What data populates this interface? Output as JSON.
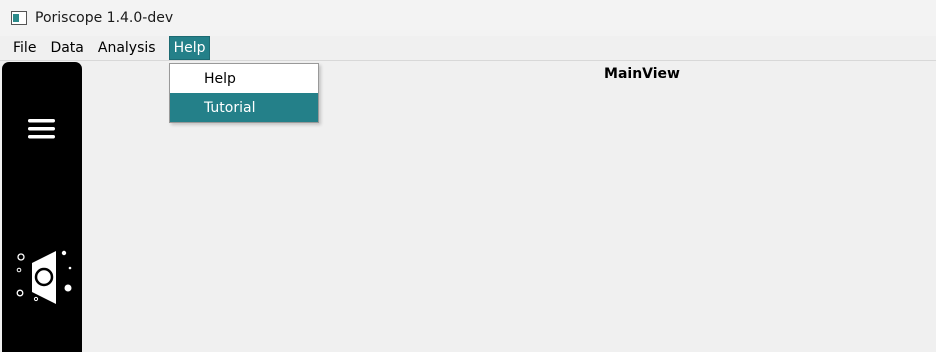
{
  "window": {
    "title": "Poriscope 1.4.0-dev",
    "app_icon": "app-window-icon"
  },
  "menubar": {
    "items": [
      {
        "label": "File",
        "active": false
      },
      {
        "label": "Data",
        "active": false
      },
      {
        "label": "Analysis",
        "active": false
      },
      {
        "label": "Help",
        "active": true
      }
    ]
  },
  "help_menu": {
    "items": [
      {
        "label": "Help",
        "highlighted": false
      },
      {
        "label": "Tutorial",
        "highlighted": true
      }
    ]
  },
  "sidebar": {
    "menu_icon": "hamburger-menu-icon",
    "logo_icon": "poriscope-logo-icon"
  },
  "main": {
    "title": "MainView"
  },
  "colors": {
    "accent": "#248089",
    "sidebar_bg": "#000000",
    "window_bg": "#f0f0f0"
  }
}
